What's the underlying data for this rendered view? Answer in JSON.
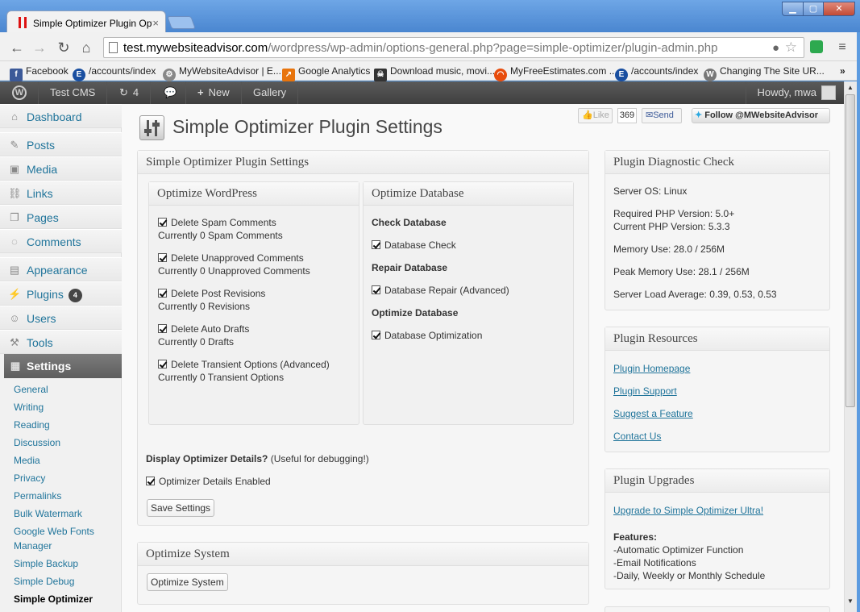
{
  "browser": {
    "tab_title": "Simple Optimizer Plugin Options",
    "tab_close": "×",
    "url_host": "test.mywebsiteadvisor.com",
    "url_path": "/wordpress/wp-admin/options-general.php?page=simple-optimizer/plugin-admin.php",
    "win_min": "▁",
    "win_max": "▢",
    "win_close": "✕"
  },
  "bookmarks": [
    {
      "label": "Facebook",
      "icon": "facebook-icon",
      "color": "#3b5998",
      "glyph": "f"
    },
    {
      "label": "/accounts/index",
      "icon": "e-icon",
      "color": "#1a4fa0",
      "glyph": "E"
    },
    {
      "label": "MyWebsiteAdvisor | E...",
      "icon": "gear-icon",
      "color": "#888888",
      "glyph": "⚙"
    },
    {
      "label": "Google Analytics",
      "icon": "analytics-icon",
      "color": "#e8740c",
      "glyph": "↗"
    },
    {
      "label": "Download music, movi...",
      "icon": "pirate-icon",
      "color": "#333333",
      "glyph": "☠"
    },
    {
      "label": "MyFreeEstimates.com ...",
      "icon": "estimates-icon",
      "color": "#e84c0c",
      "glyph": "◠"
    },
    {
      "label": "/accounts/index",
      "icon": "e-icon",
      "color": "#1a4fa0",
      "glyph": "E"
    },
    {
      "label": "Changing The Site UR...",
      "icon": "wordpress-icon",
      "color": "#777777",
      "glyph": "W"
    }
  ],
  "bookmarks_more": "»",
  "adminbar": {
    "site": "Test CMS",
    "updates": "4",
    "new": "New",
    "gallery": "Gallery",
    "howdy": "Howdy, mwa"
  },
  "sidebar": {
    "dashboard": "Dashboard",
    "posts": "Posts",
    "media": "Media",
    "links": "Links",
    "pages": "Pages",
    "comments": "Comments",
    "appearance": "Appearance",
    "plugins": "Plugins",
    "plugins_badge": "4",
    "users": "Users",
    "tools": "Tools",
    "settings": "Settings",
    "sub": [
      "General",
      "Writing",
      "Reading",
      "Discussion",
      "Media",
      "Privacy",
      "Permalinks",
      "Bulk Watermark",
      "Google Web Fonts",
      "Manager",
      "Simple Backup",
      "Simple Debug",
      "Simple Optimizer"
    ]
  },
  "page_title": "Simple Optimizer Plugin Settings",
  "social": {
    "like": "Like",
    "like_count": "369",
    "send": "Send",
    "follow": "Follow @MWebsiteAdvisor"
  },
  "settings_box": {
    "title": "Simple Optimizer Plugin Settings",
    "wp": {
      "title": "Optimize WordPress",
      "items": [
        {
          "label": "Delete Spam Comments",
          "status": "Currently 0 Spam Comments"
        },
        {
          "label": "Delete Unapproved Comments",
          "status": "Currently 0 Unapproved Comments"
        },
        {
          "label": "Delete Post Revisions",
          "status": "Currently 0 Revisions"
        },
        {
          "label": "Delete Auto Drafts",
          "status": "Currently 0 Drafts"
        },
        {
          "label": "Delete Transient Options (Advanced)",
          "status": "Currently 0 Transient Options"
        }
      ]
    },
    "db": {
      "title": "Optimize Database",
      "check_heading": "Check Database",
      "check_label": "Database Check",
      "repair_heading": "Repair Database",
      "repair_label": "Database Repair (Advanced)",
      "optimize_heading": "Optimize Database",
      "optimize_label": "Database Optimization"
    },
    "details_heading": "Display Optimizer Details?",
    "details_note": "(Useful for debugging!)",
    "details_label": "Optimizer Details Enabled",
    "save": "Save Settings"
  },
  "system_box": {
    "title": "Optimize System",
    "button": "Optimize System"
  },
  "diagnostic": {
    "title": "Plugin Diagnostic Check",
    "server_os": "Server OS: Linux",
    "req_php": "Required PHP Version: 5.0+",
    "cur_php": "Current PHP Version: 5.3.3",
    "memory": "Memory Use: 28.0 / 256M",
    "peak": "Peak Memory Use: 28.1 / 256M",
    "load": "Server Load Average: 0.39, 0.53, 0.53"
  },
  "resources": {
    "title": "Plugin Resources",
    "links": [
      "Plugin Homepage",
      "Plugin Support",
      "Suggest a Feature",
      "Contact Us"
    ]
  },
  "upgrades": {
    "title": "Plugin Upgrades",
    "link": "Upgrade to Simple Optimizer Ultra!",
    "features": "Features:",
    "list": [
      "-Automatic Optimizer Function",
      "-Email Notifications",
      "-Daily, Weekly or Monthly Schedule"
    ]
  }
}
